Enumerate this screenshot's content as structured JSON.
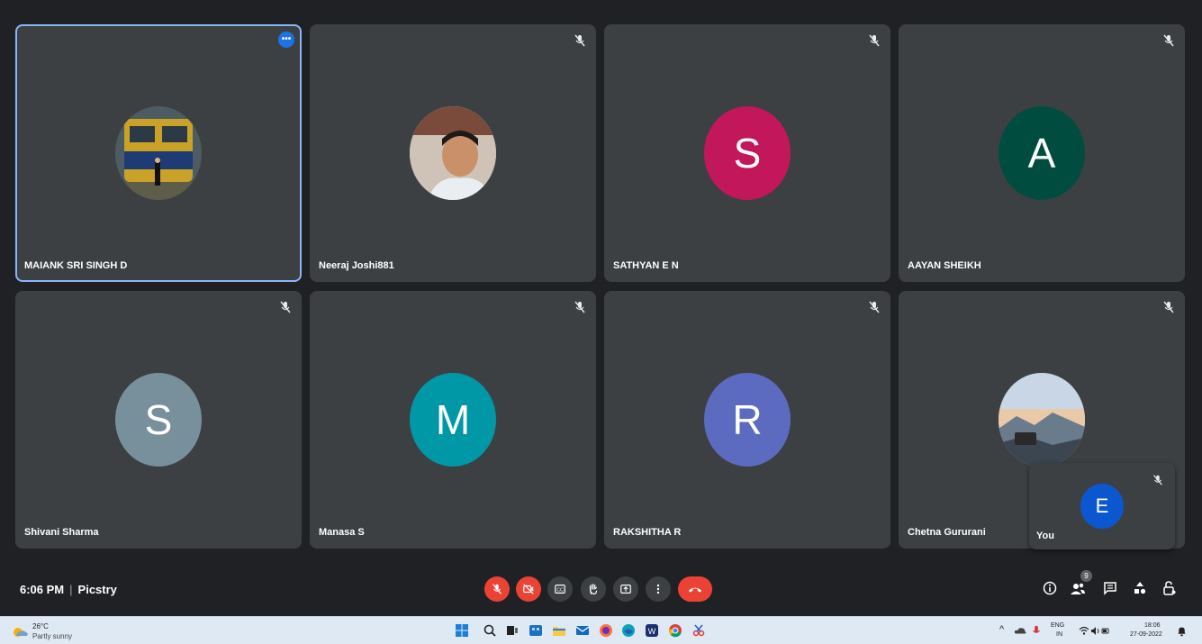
{
  "participants": [
    {
      "name": "MAIANK SRI SINGH D",
      "initial": "",
      "color": "#6b5a2a",
      "photo": "train"
    },
    {
      "name": "Neeraj Joshi881",
      "initial": "",
      "color": "#d9cfc6",
      "photo": "selfie"
    },
    {
      "name": "SATHYAN E N",
      "initial": "S",
      "color": "#c2185b",
      "photo": ""
    },
    {
      "name": "AAYAN SHEIKH",
      "initial": "A",
      "color": "#004d40",
      "photo": ""
    },
    {
      "name": "Shivani Sharma",
      "initial": "S",
      "color": "#78909c",
      "photo": ""
    },
    {
      "name": "Manasa S",
      "initial": "M",
      "color": "#0097a7",
      "photo": ""
    },
    {
      "name": "RAKSHITHA R",
      "initial": "R",
      "color": "#5c6bc0",
      "photo": ""
    },
    {
      "name": "Chetna Gururani",
      "initial": "",
      "color": "#8aa0b8",
      "photo": "mountain"
    }
  ],
  "self_view": {
    "name": "You",
    "initial": "E",
    "color": "#0b57d0"
  },
  "controls": {
    "time": "6:06 PM",
    "meeting_name": "Picstry",
    "participant_count": "9",
    "icons": [
      "mic-off-icon",
      "camera-off-icon",
      "captions-icon",
      "raise-hand-icon",
      "present-icon",
      "more-options-icon",
      "end-call-icon"
    ],
    "right_icons": [
      "info-icon",
      "people-icon",
      "chat-icon",
      "activities-icon",
      "host-controls-icon"
    ]
  },
  "taskbar": {
    "weather_temp": "26°C",
    "weather_desc": "Partly sunny",
    "lang": "ENG",
    "region": "IN",
    "time": "18:06",
    "date": "27-09-2022"
  },
  "colors": {
    "background": "#202124",
    "tile": "#3c4043",
    "accent": "#8ab4f8",
    "danger": "#ea4335"
  }
}
